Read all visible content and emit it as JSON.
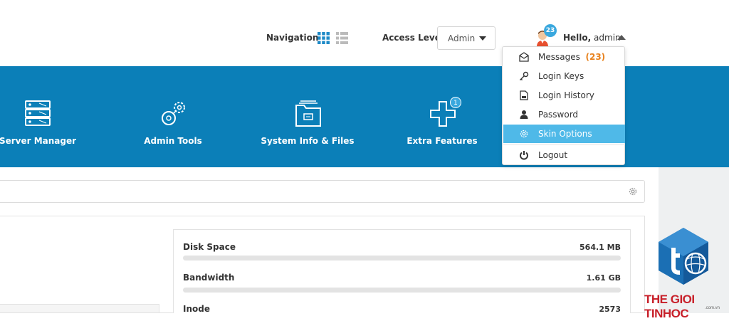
{
  "header": {
    "navigation_label": "Navigation",
    "access_level_label": "Access Level",
    "access_level_value": "Admin",
    "notification_count": "23",
    "hello_prefix": "Hello,",
    "hello_user": "admin"
  },
  "tiles": [
    {
      "label": "Server Manager",
      "icon": "server-icon"
    },
    {
      "label": "Admin Tools",
      "icon": "gears-icon"
    },
    {
      "label": "System Info & Files",
      "icon": "folder-icon"
    },
    {
      "label": "Extra Features",
      "icon": "plus-icon",
      "badge": "1"
    }
  ],
  "user_menu": {
    "items": [
      {
        "label": "Messages",
        "count": "(23)",
        "icon": "envelope-icon"
      },
      {
        "label": "Login Keys",
        "icon": "key-icon"
      },
      {
        "label": "Login History",
        "icon": "history-icon"
      },
      {
        "label": "Password",
        "icon": "user-icon"
      },
      {
        "label": "Skin Options",
        "icon": "gear-icon",
        "active": true
      },
      {
        "label": "Logout",
        "icon": "power-icon"
      }
    ]
  },
  "stats": [
    {
      "name": "Disk Space",
      "value": "564.1 MB"
    },
    {
      "name": "Bandwidth",
      "value": "1.61 GB"
    },
    {
      "name": "Inode",
      "value": "2573"
    }
  ],
  "watermark": {
    "text": "THE GIOI TINHOC",
    "sub": ".com.vn"
  },
  "colors": {
    "band": "#0b7fb8",
    "active_item": "#4fb9e8",
    "badge": "#3aa8de",
    "count": "#e8821e",
    "watermark": "#c8202a"
  }
}
